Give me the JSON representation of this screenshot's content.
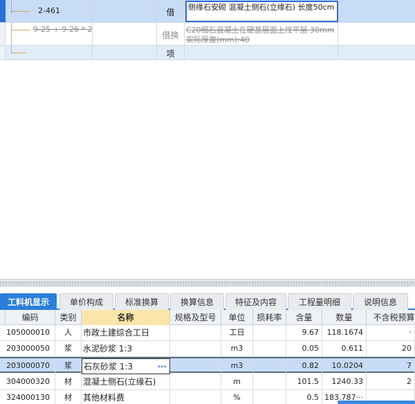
{
  "top_rows": [
    {
      "code": "2-461",
      "type": "借",
      "name": "侧缘石安砌 混凝土侧石(立缘石) 长度50cm"
    },
    {
      "code": "9-25 + 9-26 * 2",
      "type": "借换",
      "name": "C20细石混凝土在硬基层面上找平层 30mm 实际厚度(mm):40"
    },
    {
      "code": "",
      "type": "项",
      "name": ""
    }
  ],
  "tabs": [
    "工料机显示",
    "单价构成",
    "标准换算",
    "换算信息",
    "特征及内容",
    "工程量明细",
    "说明信息"
  ],
  "columns": [
    "编码",
    "类别",
    "名称",
    "规格及型号",
    "单位",
    "损耗率",
    "含量",
    "数量",
    "不含税预算"
  ],
  "rows": [
    {
      "code": "105000010",
      "cat": "人",
      "name": "市政土建综合工日",
      "spec": "",
      "unit": "工日",
      "loss": "",
      "content": "9.67",
      "qty": "118.1674",
      "price": "·"
    },
    {
      "code": "203000050",
      "cat": "浆",
      "name": "水泥砂浆 1:3",
      "spec": "",
      "unit": "m3",
      "loss": "",
      "content": "0.05",
      "qty": "0.611",
      "price": "20"
    },
    {
      "code": "203000070",
      "cat": "浆",
      "name": "石灰砂浆 1:3",
      "spec": "",
      "unit": "m3",
      "loss": "",
      "content": "0.82",
      "qty": "10.0204",
      "price": "7"
    },
    {
      "code": "304000320",
      "cat": "材",
      "name": "混凝土侧石(立缘石)",
      "spec": "",
      "unit": "m",
      "loss": "",
      "content": "101.5",
      "qty": "1240.33",
      "price": "2"
    },
    {
      "code": "324000130",
      "cat": "材",
      "name": "其他材料费",
      "spec": "",
      "unit": "%",
      "loss": "",
      "content": "0.5",
      "qty": "183.787···",
      "price": ""
    }
  ],
  "name_editor_ellipsis": "···",
  "colors": {
    "accent": "#2b7fdb",
    "selected_row": "#c8dcf7",
    "header_sel": "#fbe6a9"
  }
}
